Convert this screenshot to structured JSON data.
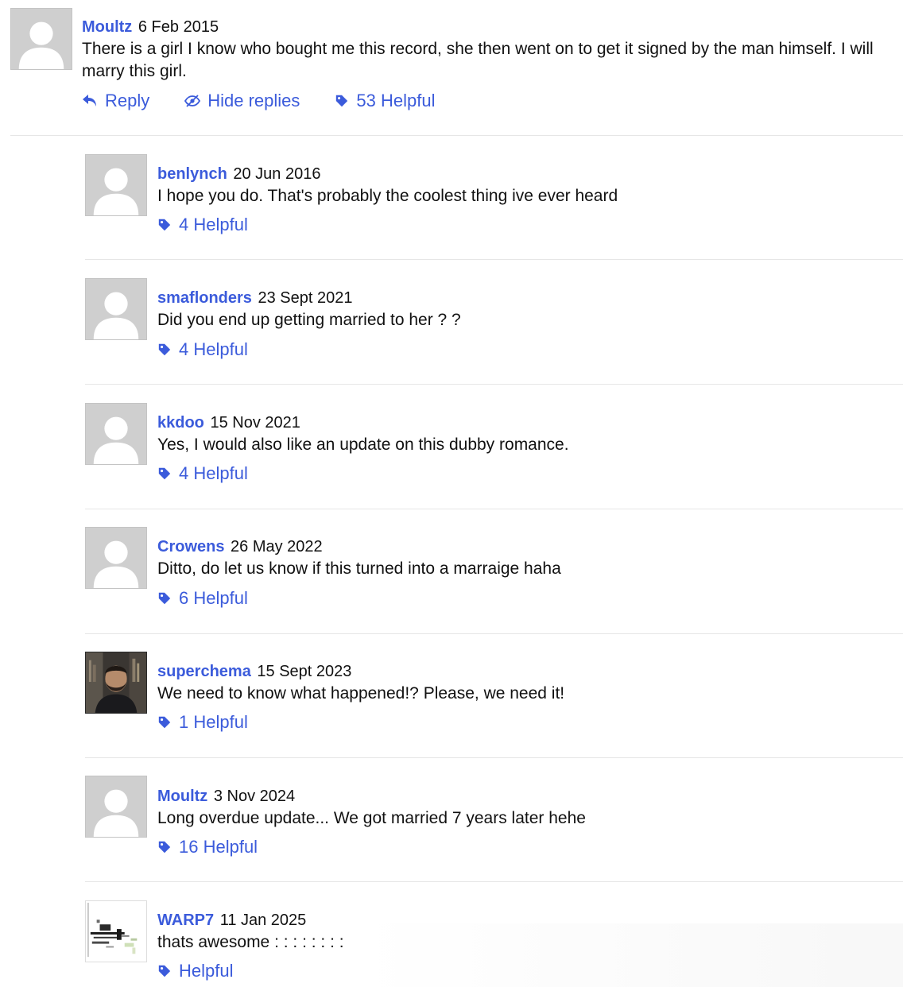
{
  "colors": {
    "link": "#3b5bdb",
    "text": "#111111",
    "avatar_bg": "#cfcfcf",
    "divider": "#e6e6e6"
  },
  "main_comment": {
    "username": "Moultz",
    "date": "6 Feb 2015",
    "text": "There is a girl I know who bought me this record, she then went on to get it signed by the man himself. I will marry this girl.",
    "reply_label": "Reply",
    "hide_replies_label": "Hide replies",
    "helpful_label": "53 Helpful",
    "avatar": "default-avatar-icon"
  },
  "replies": [
    {
      "username": "benlynch",
      "date": "20 Jun 2016",
      "text": "I hope you do. That's probably the coolest thing ive ever heard",
      "helpful_label": "4 Helpful",
      "avatar": "default-avatar-icon"
    },
    {
      "username": "smaflonders",
      "date": "23 Sept 2021",
      "text": "Did you end up getting married to her ? ?",
      "helpful_label": "4 Helpful",
      "avatar": "default-avatar-icon"
    },
    {
      "username": "kkdoo",
      "date": "15 Nov 2021",
      "text": "Yes, I would also like an update on this dubby romance.",
      "helpful_label": "4 Helpful",
      "avatar": "default-avatar-icon"
    },
    {
      "username": "Crowens",
      "date": "26 May 2022",
      "text": "Ditto, do let us know if this turned into a marraige haha",
      "helpful_label": "6 Helpful",
      "avatar": "default-avatar-icon"
    },
    {
      "username": "superchema",
      "date": "15 Sept 2023",
      "text": "We need to know what happened!? Please, we need it!",
      "helpful_label": "1 Helpful",
      "avatar": "user-photo-avatar"
    },
    {
      "username": "Moultz",
      "date": "3 Nov 2024",
      "text": "Long overdue update... We got married 7 years later hehe",
      "helpful_label": "16 Helpful",
      "avatar": "default-avatar-icon"
    },
    {
      "username": "WARP7",
      "date": "11 Jan 2025",
      "text": "thats awesome : : : : : : : :",
      "helpful_label": "Helpful",
      "avatar": "abstract-image-avatar"
    }
  ]
}
